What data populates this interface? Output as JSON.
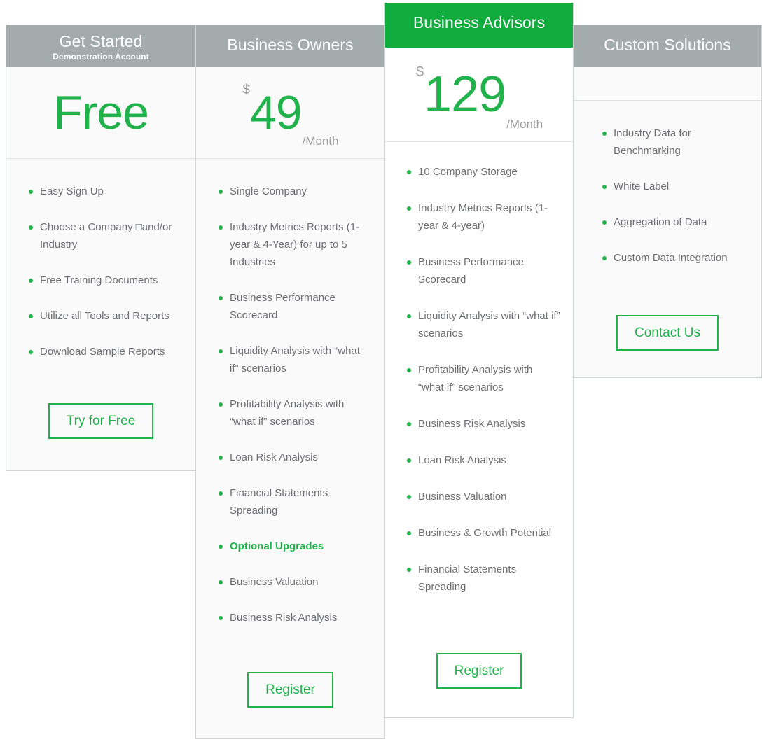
{
  "plans": [
    {
      "id": "get-started",
      "title": "Get Started",
      "subtitle": "Demonstration Account",
      "featured": false,
      "price": {
        "currency": "",
        "amount": "Free",
        "period": ""
      },
      "features": [
        "Easy Sign Up",
        "Choose a Company □and/or Industry",
        "Free Training Documents",
        "Utilize all Tools and Reports",
        "Download Sample Reports"
      ],
      "cta": "Try for Free"
    },
    {
      "id": "business-owners",
      "title": "Business Owners",
      "subtitle": "",
      "featured": false,
      "price": {
        "currency": "$",
        "amount": "49",
        "period": "/Month"
      },
      "features": [
        "Single Company",
        "Industry Metrics Reports (1-year & 4-Year) for up to 5 Industries",
        "Business Performance Scorecard",
        "Liquidity Analysis with “what if” scenarios",
        "Profitability Analysis with “what if” scenarios",
        "Loan Risk Analysis",
        "Financial Statements Spreading",
        "Optional Upgrades",
        "Business Valuation",
        "Business Risk Analysis"
      ],
      "highlight_index": 7,
      "cta": "Register"
    },
    {
      "id": "business-advisors",
      "title": "Business Advisors",
      "subtitle": "",
      "featured": true,
      "price": {
        "currency": "$",
        "amount": "129",
        "period": "/Month"
      },
      "features": [
        "10 Company Storage",
        "Industry Metrics Reports (1-year & 4-year)",
        "Business Performance Scorecard",
        "Liquidity Analysis with “what if” scenarios",
        "Profitability Analysis with “what if” scenarios",
        "Business Risk Analysis",
        "Loan Risk Analysis",
        "Business Valuation",
        "Business & Growth Potential",
        "Financial Statements Spreading"
      ],
      "cta": "Register"
    },
    {
      "id": "custom-solutions",
      "title": "Custom Solutions",
      "subtitle": "",
      "featured": false,
      "price": {
        "currency": "",
        "amount": "",
        "period": ""
      },
      "features": [
        "Industry Data for Benchmarking",
        "White Label",
        "Aggregation of Data",
        "Custom Data Integration"
      ],
      "cta": "Contact Us"
    }
  ],
  "colors": {
    "accent_green": "#22b24c",
    "featured_header_green": "#10ac3e",
    "header_gray": "#a3abab",
    "body_text": "#6e6f72",
    "muted_gray": "#9b9b9b",
    "card_background": "#fafafa",
    "featured_card_background": "#ffffff",
    "border": "#cfd4d4"
  }
}
